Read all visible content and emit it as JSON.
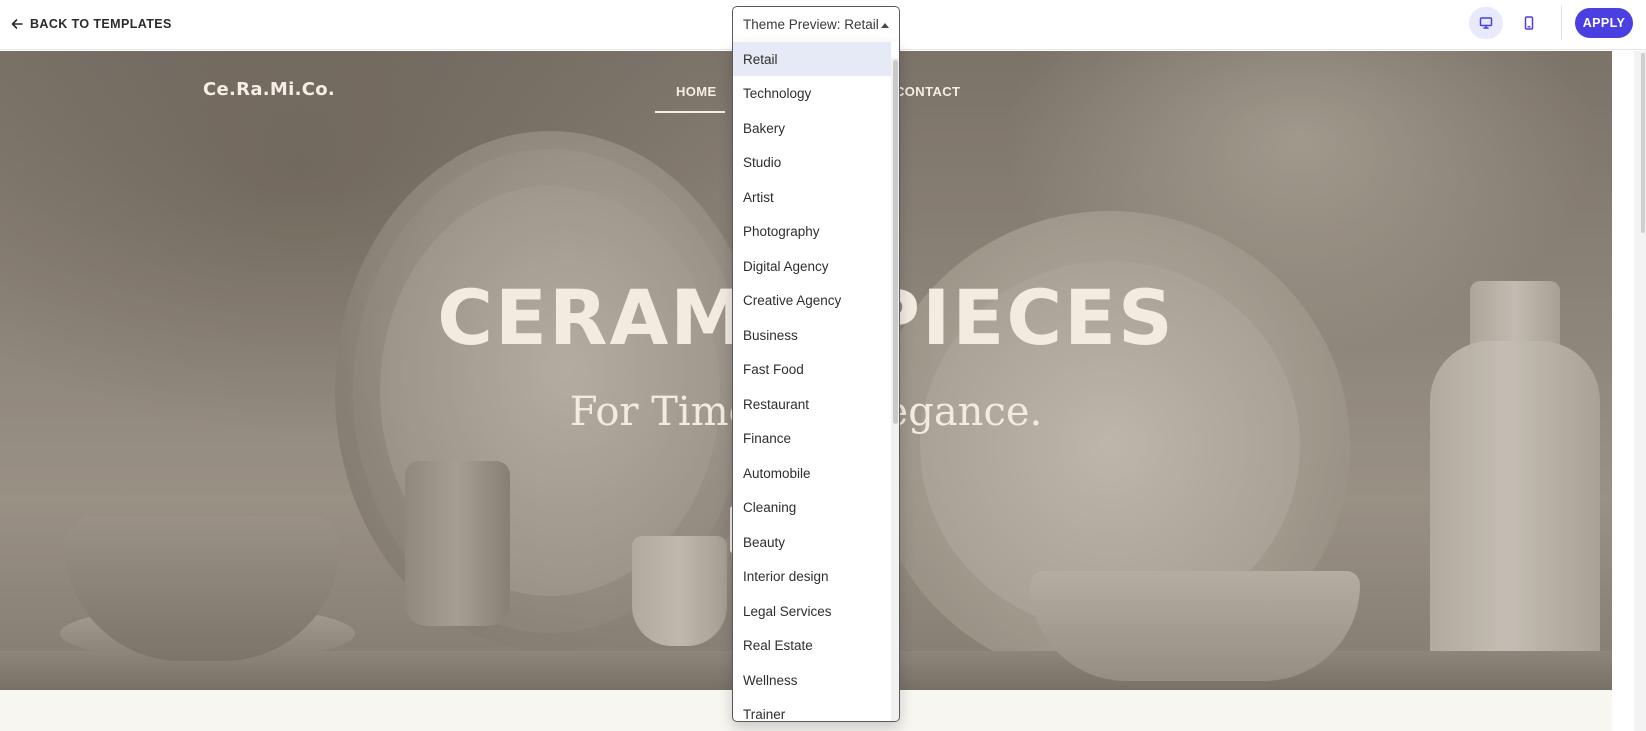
{
  "toolbar": {
    "back_label": "BACK TO TEMPLATES",
    "apply_label": "APPLY",
    "accent_color": "#4a3fe0",
    "back_icon": "arrow-left-icon",
    "desktop_icon": "desktop-monitor-icon",
    "mobile_icon": "mobile-phone-icon",
    "active_device": "desktop"
  },
  "theme_select": {
    "value": "Theme Preview: Retail",
    "selected_option": "Retail",
    "options": [
      "Retail",
      "Technology",
      "Bakery",
      "Studio",
      "Artist",
      "Photography",
      "Digital Agency",
      "Creative Agency",
      "Business",
      "Fast Food",
      "Restaurant",
      "Finance",
      "Automobile",
      "Cleaning",
      "Beauty",
      "Interior design",
      "Legal Services",
      "Real Estate",
      "Wellness",
      "Trainer"
    ]
  },
  "preview": {
    "logo": "Ce.Ra.Mi.Co.",
    "nav_home": "HOME",
    "nav_contact": "CONTACT",
    "hero_title": "CERAMIC PIECES",
    "hero_subtitle": "For Timeless Elegance."
  }
}
